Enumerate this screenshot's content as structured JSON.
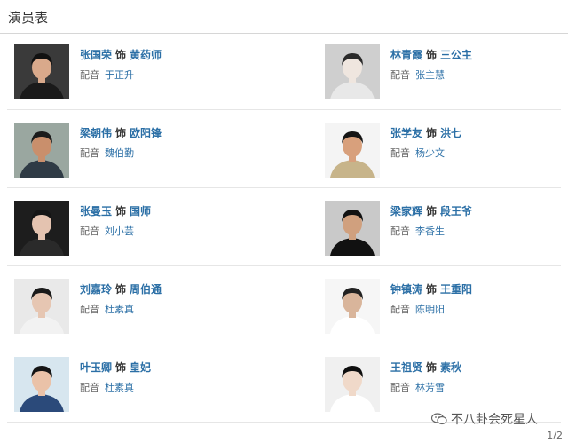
{
  "header": {
    "title": "演员表"
  },
  "cast": [
    [
      {
        "actor": "张国荣",
        "as": "饰",
        "role": "黄药师",
        "dub_label": "配音",
        "dub": "于正升",
        "photo": {
          "bg": "#3a3a3a",
          "skin": "#d9a98b",
          "hair": "#111111",
          "shirt": "#1a1a1a"
        }
      },
      {
        "actor": "林青霞",
        "as": "饰",
        "role": "三公主",
        "dub_label": "配音",
        "dub": "张主慧",
        "photo": {
          "bg": "#cfcfcf",
          "skin": "#efe6df",
          "hair": "#2a2a2a",
          "shirt": "#e8e8e8"
        }
      }
    ],
    [
      {
        "actor": "梁朝伟",
        "as": "饰",
        "role": "欧阳锋",
        "dub_label": "配音",
        "dub": "魏伯勤",
        "photo": {
          "bg": "#9aa7a0",
          "skin": "#c98f6c",
          "hair": "#1b1b1b",
          "shirt": "#2f3b45"
        }
      },
      {
        "actor": "张学友",
        "as": "饰",
        "role": "洪七",
        "dub_label": "配音",
        "dub": "杨少文",
        "photo": {
          "bg": "#f4f4f4",
          "skin": "#d8a07c",
          "hair": "#141414",
          "shirt": "#c7b48a"
        }
      }
    ],
    [
      {
        "actor": "张曼玉",
        "as": "饰",
        "role": "国师",
        "dub_label": "配音",
        "dub": "刘小芸",
        "photo": {
          "bg": "#1d1d1d",
          "skin": "#e4c3b0",
          "hair": "#151515",
          "shirt": "#2a2a2a"
        }
      },
      {
        "actor": "梁家辉",
        "as": "饰",
        "role": "段王爷",
        "dub_label": "配音",
        "dub": "李香生",
        "photo": {
          "bg": "#c9c9c9",
          "skin": "#d0a07e",
          "hair": "#121212",
          "shirt": "#111111"
        }
      }
    ],
    [
      {
        "actor": "刘嘉玲",
        "as": "饰",
        "role": "周伯通",
        "dub_label": "配音",
        "dub": "杜素真",
        "photo": {
          "bg": "#e9e9e9",
          "skin": "#e6c6b2",
          "hair": "#1a1a1a",
          "shirt": "#f2f2f2"
        }
      },
      {
        "actor": "钟镇涛",
        "as": "饰",
        "role": "王重阳",
        "dub_label": "配音",
        "dub": "陈明阳",
        "photo": {
          "bg": "#f6f6f6",
          "skin": "#d9b59b",
          "hair": "#222222",
          "shirt": "#ffffff"
        }
      }
    ],
    [
      {
        "actor": "叶玉卿",
        "as": "饰",
        "role": "皇妃",
        "dub_label": "配音",
        "dub": "杜素真",
        "photo": {
          "bg": "#d7e6ef",
          "skin": "#eac2a8",
          "hair": "#151515",
          "shirt": "#2b4a7a"
        }
      },
      {
        "actor": "王祖贤",
        "as": "饰",
        "role": "素秋",
        "dub_label": "配音",
        "dub": "林芳雪",
        "photo": {
          "bg": "#f0f0f0",
          "skin": "#f0d9c9",
          "hair": "#0f0f0f",
          "shirt": "#ffffff"
        }
      }
    ]
  ],
  "watermark": {
    "text": "不八卦会死星人",
    "icon": "wechat-icon"
  },
  "page": {
    "indicator": "1/2"
  },
  "colors": {
    "link": "#2b6fa6",
    "divider": "#e6e6e6"
  }
}
